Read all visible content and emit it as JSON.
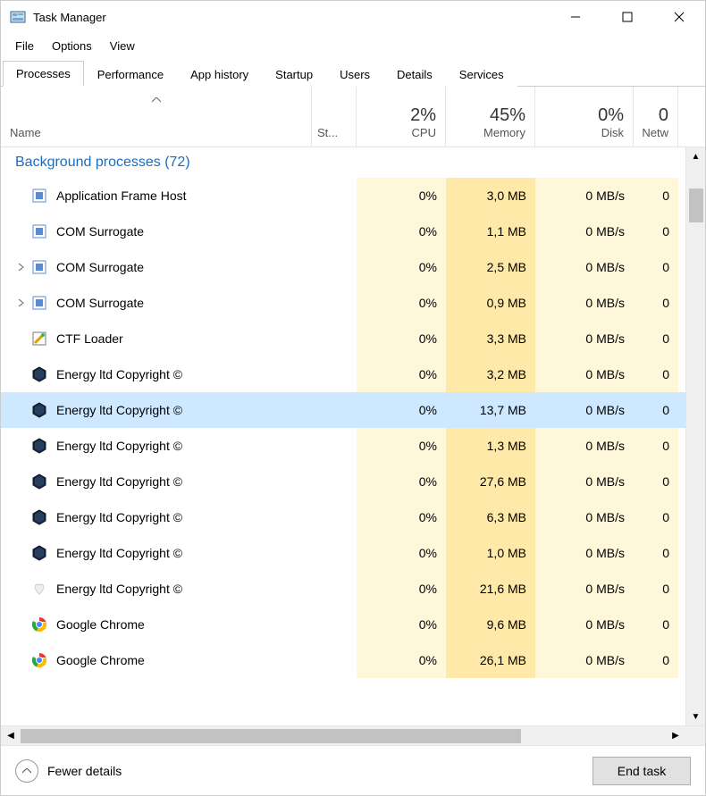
{
  "window": {
    "title": "Task Manager"
  },
  "menu": {
    "file": "File",
    "options": "Options",
    "view": "View"
  },
  "tabs": [
    "Processes",
    "Performance",
    "App history",
    "Startup",
    "Users",
    "Details",
    "Services"
  ],
  "active_tab": 0,
  "columns": {
    "name": "Name",
    "status_short": "St...",
    "cpu": {
      "pct": "2%",
      "label": "CPU"
    },
    "memory": {
      "pct": "45%",
      "label": "Memory"
    },
    "disk": {
      "pct": "0%",
      "label": "Disk"
    },
    "network": {
      "pct": "0",
      "label": "Netw"
    }
  },
  "group_header": "Background processes (72)",
  "processes": [
    {
      "name": "Application Frame Host",
      "icon": "app-frame",
      "expand": false,
      "cpu": "0%",
      "mem": "3,0 MB",
      "disk": "0 MB/s",
      "net": "0",
      "selected": false
    },
    {
      "name": "COM Surrogate",
      "icon": "com",
      "expand": false,
      "cpu": "0%",
      "mem": "1,1 MB",
      "disk": "0 MB/s",
      "net": "0",
      "selected": false
    },
    {
      "name": "COM Surrogate",
      "icon": "com",
      "expand": true,
      "cpu": "0%",
      "mem": "2,5 MB",
      "disk": "0 MB/s",
      "net": "0",
      "selected": false
    },
    {
      "name": "COM Surrogate",
      "icon": "com",
      "expand": true,
      "cpu": "0%",
      "mem": "0,9 MB",
      "disk": "0 MB/s",
      "net": "0",
      "selected": false
    },
    {
      "name": "CTF Loader",
      "icon": "ctf",
      "expand": false,
      "cpu": "0%",
      "mem": "3,3 MB",
      "disk": "0 MB/s",
      "net": "0",
      "selected": false
    },
    {
      "name": "Energy ltd Copyright ©",
      "icon": "hex",
      "expand": false,
      "cpu": "0%",
      "mem": "3,2 MB",
      "disk": "0 MB/s",
      "net": "0",
      "selected": false
    },
    {
      "name": "Energy ltd Copyright ©",
      "icon": "hex",
      "expand": false,
      "cpu": "0%",
      "mem": "13,7 MB",
      "disk": "0 MB/s",
      "net": "0",
      "selected": true
    },
    {
      "name": "Energy ltd Copyright ©",
      "icon": "hex",
      "expand": false,
      "cpu": "0%",
      "mem": "1,3 MB",
      "disk": "0 MB/s",
      "net": "0",
      "selected": false
    },
    {
      "name": "Energy ltd Copyright ©",
      "icon": "hex",
      "expand": false,
      "cpu": "0%",
      "mem": "27,6 MB",
      "disk": "0 MB/s",
      "net": "0",
      "selected": false
    },
    {
      "name": "Energy ltd Copyright ©",
      "icon": "hex",
      "expand": false,
      "cpu": "0%",
      "mem": "6,3 MB",
      "disk": "0 MB/s",
      "net": "0",
      "selected": false
    },
    {
      "name": "Energy ltd Copyright ©",
      "icon": "hex",
      "expand": false,
      "cpu": "0%",
      "mem": "1,0 MB",
      "disk": "0 MB/s",
      "net": "0",
      "selected": false
    },
    {
      "name": "Energy ltd Copyright ©",
      "icon": "heart",
      "expand": false,
      "cpu": "0%",
      "mem": "21,6 MB",
      "disk": "0 MB/s",
      "net": "0",
      "selected": false
    },
    {
      "name": "Google Chrome",
      "icon": "chrome",
      "expand": false,
      "cpu": "0%",
      "mem": "9,6 MB",
      "disk": "0 MB/s",
      "net": "0",
      "selected": false
    },
    {
      "name": "Google Chrome",
      "icon": "chrome",
      "expand": false,
      "cpu": "0%",
      "mem": "26,1 MB",
      "disk": "0 MB/s",
      "net": "0",
      "selected": false
    }
  ],
  "footer": {
    "fewer": "Fewer details",
    "end_task": "End task"
  }
}
